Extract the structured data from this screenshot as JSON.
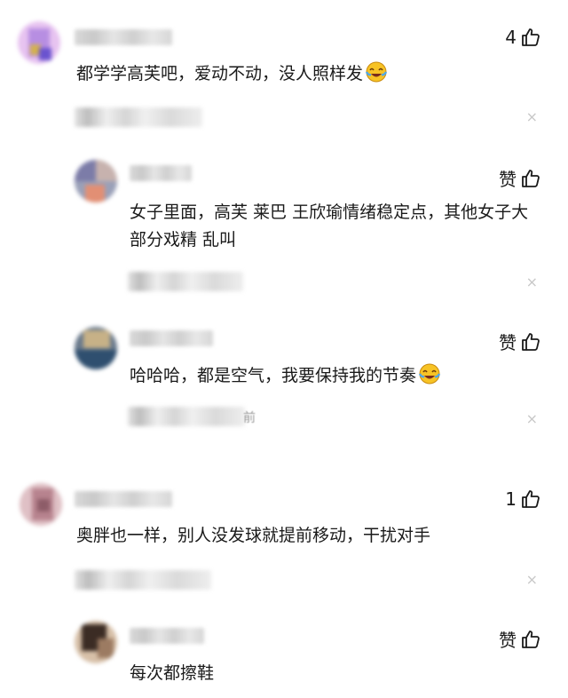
{
  "comments": [
    {
      "like_count": "4",
      "text": "都学学高芙吧，爱动不动，没人照样发",
      "avatar_colors": [
        "#e7c3f0",
        "#c7a1e5",
        "#7a5fd0",
        "#d4b24e"
      ]
    },
    {
      "like_label": "赞",
      "text": "女子里面，高芙 莱巴 王欣瑜情绪稳定点，其他女子大部分戏精 乱叫",
      "avatar_colors": [
        "#8f8fb0",
        "#c9b7b0",
        "#e28f74"
      ]
    },
    {
      "like_label": "赞",
      "text": "哈哈哈，都是空气，我要保持我的节奏",
      "meta_suffix": "前",
      "avatar_colors": [
        "#6a7a8c",
        "#c7b187",
        "#2f4f6f"
      ]
    },
    {
      "like_count": "1",
      "text": "奥胖也一样，别人没发球就提前移动，干扰对手",
      "avatar_colors": [
        "#c99aa5",
        "#dfc0c5",
        "#8d5c68"
      ]
    },
    {
      "like_label": "赞",
      "text": "每次都擦鞋",
      "avatar_colors": [
        "#3b2c24",
        "#9c7b62",
        "#d7c0a8"
      ]
    }
  ],
  "icons": {
    "thumb": "thumbs-up-icon",
    "close": "close-icon",
    "emoji": "laughing-tears-emoji"
  },
  "close_glyph": "×"
}
